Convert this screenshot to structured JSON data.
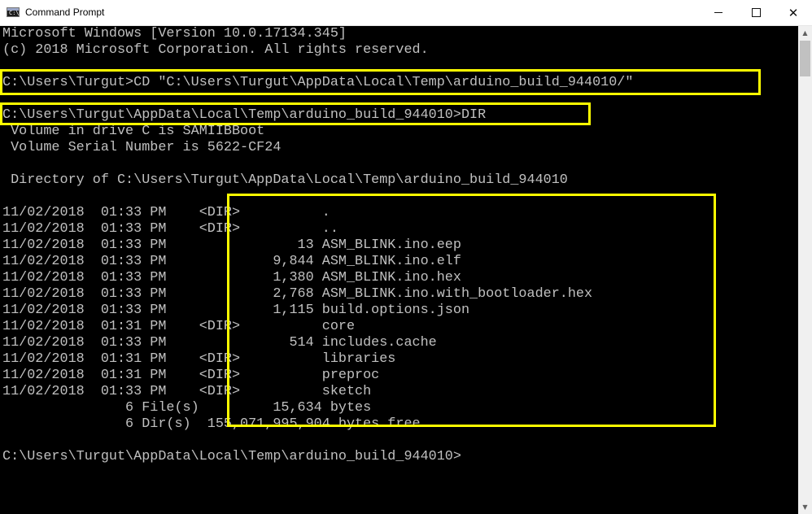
{
  "window": {
    "title": "Command Prompt",
    "icon_text": "C:\\",
    "controls": {
      "minimize": "minimize-icon",
      "maximize": "maximize-icon",
      "close": "close-icon"
    }
  },
  "console": {
    "text_color": "#c0c0c0",
    "background": "#000000",
    "highlight_color": "#ffff00",
    "lines": [
      "Microsoft Windows [Version 10.0.17134.345]",
      "(c) 2018 Microsoft Corporation. All rights reserved.",
      "",
      "C:\\Users\\Turgut>CD \"C:\\Users\\Turgut\\AppData\\Local\\Temp\\arduino_build_944010/\"",
      "",
      "C:\\Users\\Turgut\\AppData\\Local\\Temp\\arduino_build_944010>DIR",
      " Volume in drive C is SAMIIBBoot",
      " Volume Serial Number is 5622-CF24",
      "",
      " Directory of C:\\Users\\Turgut\\AppData\\Local\\Temp\\arduino_build_944010",
      "",
      "11/02/2018  01:33 PM    <DIR>          .",
      "11/02/2018  01:33 PM    <DIR>          ..",
      "11/02/2018  01:33 PM                13 ASM_BLINK.ino.eep",
      "11/02/2018  01:33 PM             9,844 ASM_BLINK.ino.elf",
      "11/02/2018  01:33 PM             1,380 ASM_BLINK.ino.hex",
      "11/02/2018  01:33 PM             2,768 ASM_BLINK.ino.with_bootloader.hex",
      "11/02/2018  01:33 PM             1,115 build.options.json",
      "11/02/2018  01:31 PM    <DIR>          core",
      "11/02/2018  01:33 PM               514 includes.cache",
      "11/02/2018  01:31 PM    <DIR>          libraries",
      "11/02/2018  01:31 PM    <DIR>          preproc",
      "11/02/2018  01:33 PM    <DIR>          sketch",
      "               6 File(s)         15,634 bytes",
      "               6 Dir(s)  155,071,995,904 bytes free",
      "",
      "C:\\Users\\Turgut\\AppData\\Local\\Temp\\arduino_build_944010>"
    ]
  }
}
